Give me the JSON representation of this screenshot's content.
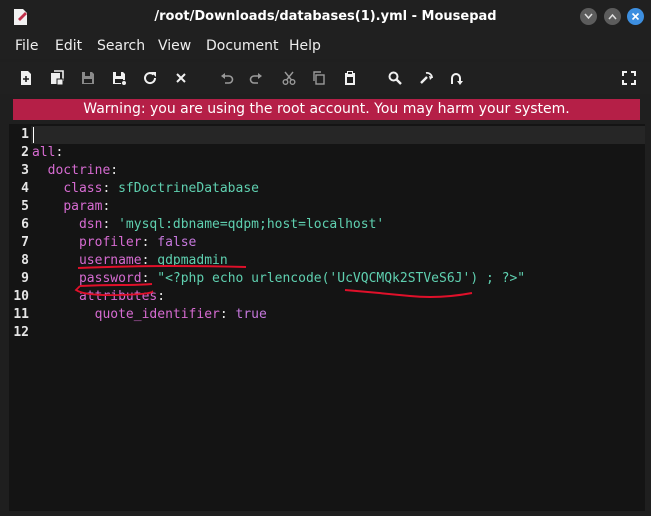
{
  "window": {
    "title": "/root/Downloads/databases(1).yml - Mousepad"
  },
  "menu": [
    "File",
    "Edit",
    "Search",
    "View",
    "Document",
    "Help"
  ],
  "toolbar": {
    "icons": [
      "new-document-icon",
      "new-window-icon",
      "save-icon",
      "save-as-icon",
      "reload-icon",
      "close-icon",
      "undo-icon",
      "redo-icon",
      "cut-icon",
      "copy-icon",
      "paste-icon",
      "find-icon",
      "find-replace-icon",
      "goto-line-icon",
      "fullscreen-icon"
    ]
  },
  "warning": "Warning: you are using the root account. You may harm your system.",
  "line_numbers": [
    "1",
    "2",
    "3",
    "4",
    "5",
    "6",
    "7",
    "8",
    "9",
    "10",
    "11",
    "12"
  ],
  "code": {
    "l2_key": "all",
    "colon": ":",
    "l3_key": "doctrine",
    "l4_key": "class",
    "l4_val": "sfDoctrineDatabase",
    "l5_key": "param",
    "l6_key": "dsn",
    "l6_val": "'mysql:dbname=qdpm;host=localhost'",
    "l7_key": "profiler",
    "l7_val": "false",
    "l8_key": "username",
    "l8_val": "qdpmadmin",
    "l9_key": "password",
    "l9_val": "\"<?php echo urlencode('UcVQCMQk2STVeS6J') ; ?>\"",
    "l10_key": "attributes",
    "l11_key": "quote_identifier",
    "l11_val": "true"
  },
  "colors": {
    "warning_bg": "#b51f47",
    "key": "#d66bd1",
    "value": "#5fd0b0",
    "annotation": "#e0102a"
  }
}
